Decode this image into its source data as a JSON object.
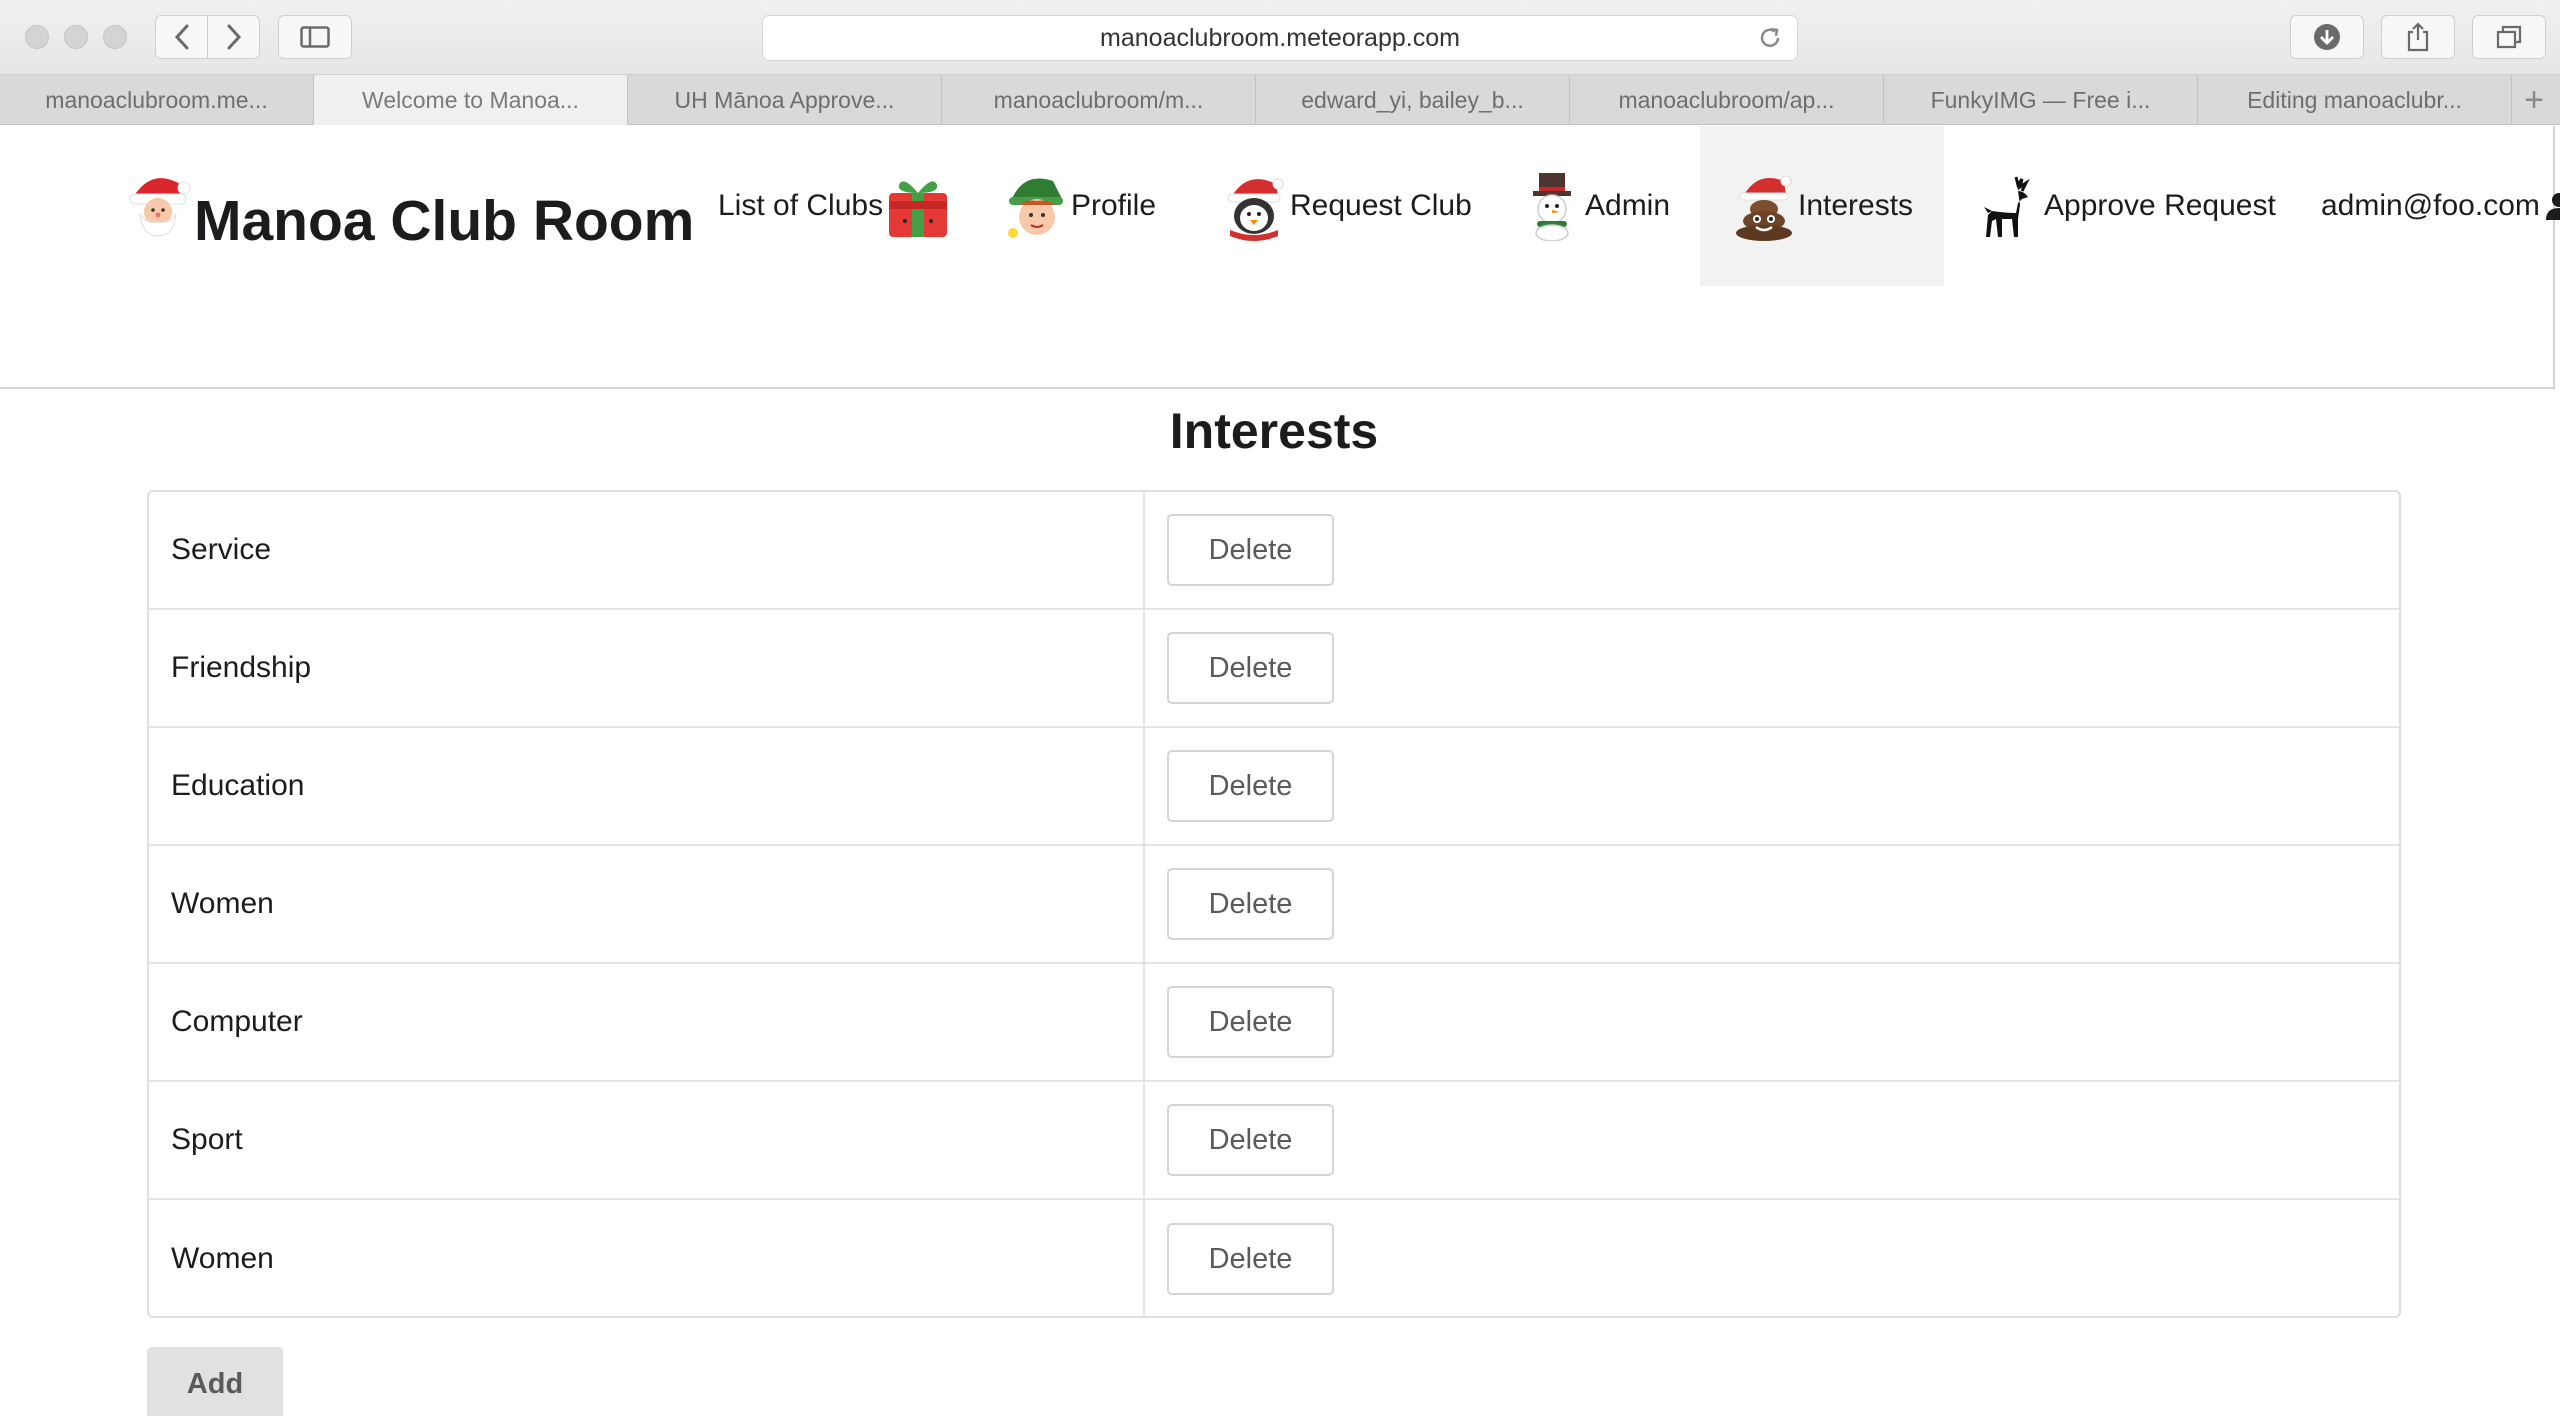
{
  "browser": {
    "url": "manoaclubroom.meteorapp.com",
    "tabs": [
      {
        "label": "manoaclubroom.me...",
        "active": false
      },
      {
        "label": "Welcome to Manoa...",
        "active": true
      },
      {
        "label": "UH Mānoa Approve...",
        "active": false
      },
      {
        "label": "manoaclubroom/m...",
        "active": false
      },
      {
        "label": "edward_yi, bailey_b...",
        "active": false
      },
      {
        "label": "manoaclubroom/ap...",
        "active": false
      },
      {
        "label": "FunkyIMG — Free i...",
        "active": false
      },
      {
        "label": "Editing manoaclubr...",
        "active": false
      }
    ],
    "new_tab_label": "+"
  },
  "navbar": {
    "brand": "Manoa Club Room",
    "items": [
      {
        "label": "List of Clubs",
        "icon": "gift-icon"
      },
      {
        "label": "Profile",
        "icon": "elf-icon"
      },
      {
        "label": "Request Club",
        "icon": "penguin-santa-icon"
      },
      {
        "label": "Admin",
        "icon": "snowman-icon"
      },
      {
        "label": "Interests",
        "icon": "poop-santa-hat-icon",
        "active": true
      },
      {
        "label": "Approve Request",
        "icon": "reindeer-icon"
      },
      {
        "label": "admin@foo.com",
        "icon": "user-icon"
      }
    ]
  },
  "main": {
    "title": "Interests",
    "rows": [
      {
        "name": "Service",
        "action": "Delete"
      },
      {
        "name": "Friendship",
        "action": "Delete"
      },
      {
        "name": "Education",
        "action": "Delete"
      },
      {
        "name": "Women",
        "action": "Delete"
      },
      {
        "name": "Computer",
        "action": "Delete"
      },
      {
        "name": "Sport",
        "action": "Delete"
      },
      {
        "name": "Women",
        "action": "Delete"
      }
    ],
    "add_label": "Add"
  },
  "colors": {
    "text": "#1b1c1d",
    "border": "#dededf",
    "add_button_bg": "#e0e1e2",
    "active_nav_bg": "#f2f2f2"
  }
}
